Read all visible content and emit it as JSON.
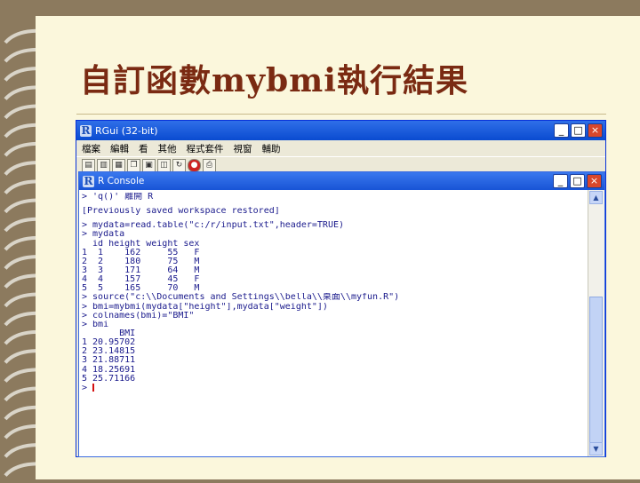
{
  "slide": {
    "title": "自訂函數mybmi執行結果"
  },
  "rgui": {
    "title": "RGui (32-bit)",
    "menu": [
      "檔案",
      "編輯",
      "看",
      "其他",
      "程式套件",
      "視窗",
      "輔助"
    ],
    "window_buttons": {
      "minimize": "_",
      "maximize": "□",
      "close": "×"
    }
  },
  "console": {
    "title": "R Console",
    "lines": [
      "> 'q()' 離開 R",
      "",
      "[Previously saved workspace restored]",
      "",
      "> mydata=read.table(\"c:/r/input.txt\",header=TRUE)",
      "> mydata",
      "  id height weight sex",
      "1  1    162     55   F",
      "2  2    180     75   M",
      "3  3    171     64   M",
      "4  4    157     45   F",
      "5  5    165     70   M",
      "> source(\"c:\\\\Documents and Settings\\\\bella\\\\桌面\\\\myfun.R\")",
      "> bmi=mybmi(mydata[\"height\"],mydata[\"weight\"])",
      "> colnames(bmi)=\"BMI\"",
      "> bmi",
      "       BMI",
      "1 20.95702",
      "2 23.14815",
      "3 21.88711",
      "4 18.25691",
      "5 25.71166",
      "> "
    ]
  }
}
